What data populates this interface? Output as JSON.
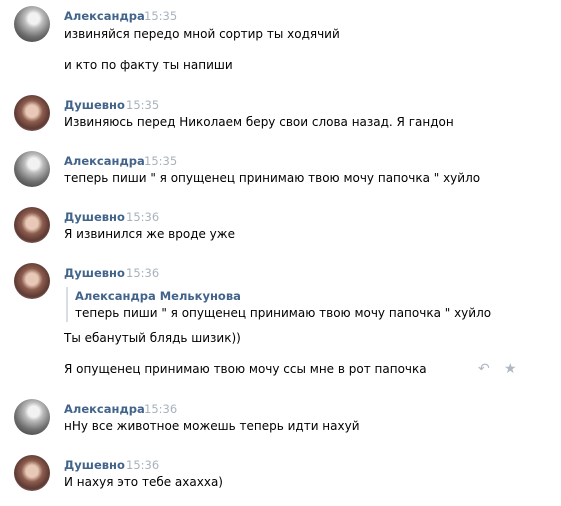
{
  "messages": [
    {
      "author": "Александра",
      "time": "15:35",
      "lines": [
        "извиняйся передо мной сортир ты ходячий",
        "и кто по факту ты напиши"
      ]
    },
    {
      "author": "Душевно",
      "time": "15:35",
      "lines": [
        "Извиняюсь перед Николаем беру свои слова назад. Я гандон"
      ]
    },
    {
      "author": "Александра",
      "time": "15:35",
      "lines": [
        "теперь пиши \" я опущенец принимаю твою мочу папочка \" хуйло"
      ]
    },
    {
      "author": "Душевно",
      "time": "15:36",
      "lines": [
        "Я извинился же вроде уже"
      ]
    },
    {
      "author": "Душевно",
      "time": "15:36",
      "forward": {
        "author": "Александра Мелькунова",
        "text": "теперь пиши \" я опущенец принимаю твою мочу папочка \" хуйло"
      },
      "lines": [
        "Ты ебанутый блядь шизик))"
      ]
    },
    {
      "lines": [
        "Я опущенец принимаю твою мочу ссы мне в рот папочка"
      ],
      "actions": {
        "reply_icon": "reply-icon",
        "star_icon": "star-icon",
        "reply_glyph": "↶",
        "star_glyph": "★"
      }
    },
    {
      "author": "Александра",
      "time": "15:36",
      "lines": [
        "нНу все животное можешь теперь идти нахуй"
      ]
    },
    {
      "author": "Душевно",
      "time": "15:36",
      "lines": [
        "И нахуя это тебе ахахха)"
      ]
    }
  ]
}
